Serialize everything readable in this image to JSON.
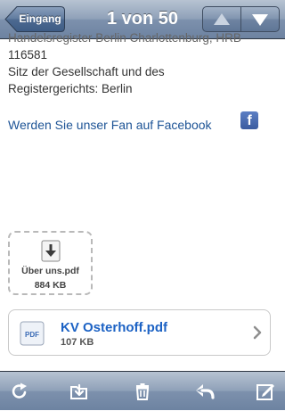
{
  "nav": {
    "back_label": "Eingang",
    "title": "1 von 50"
  },
  "message": {
    "partial_line": "Handelsregister Berlin Charlottenburg, HRB",
    "lines": [
      "116581",
      "Sitz der Gesellschaft und des",
      "Registergerichts: Berlin"
    ],
    "facebook_link": "Werden Sie unser Fan auf Facebook",
    "facebook_icon_glyph": "f"
  },
  "attachments": [
    {
      "name": "Über uns.pdf",
      "size": "884 KB",
      "icon": "download-icon"
    },
    {
      "name": "KV Osterhoff.pdf",
      "size": "107 KB",
      "icon": "pdf-icon",
      "icon_label": "PDF"
    }
  ],
  "toolbar": {
    "buttons": [
      "refresh-icon",
      "move-to-folder-icon",
      "trash-icon",
      "reply-icon",
      "compose-icon"
    ]
  },
  "colors": {
    "link": "#1e5496",
    "attachment_link": "#1c62c4",
    "bar": "#7d91ad"
  }
}
